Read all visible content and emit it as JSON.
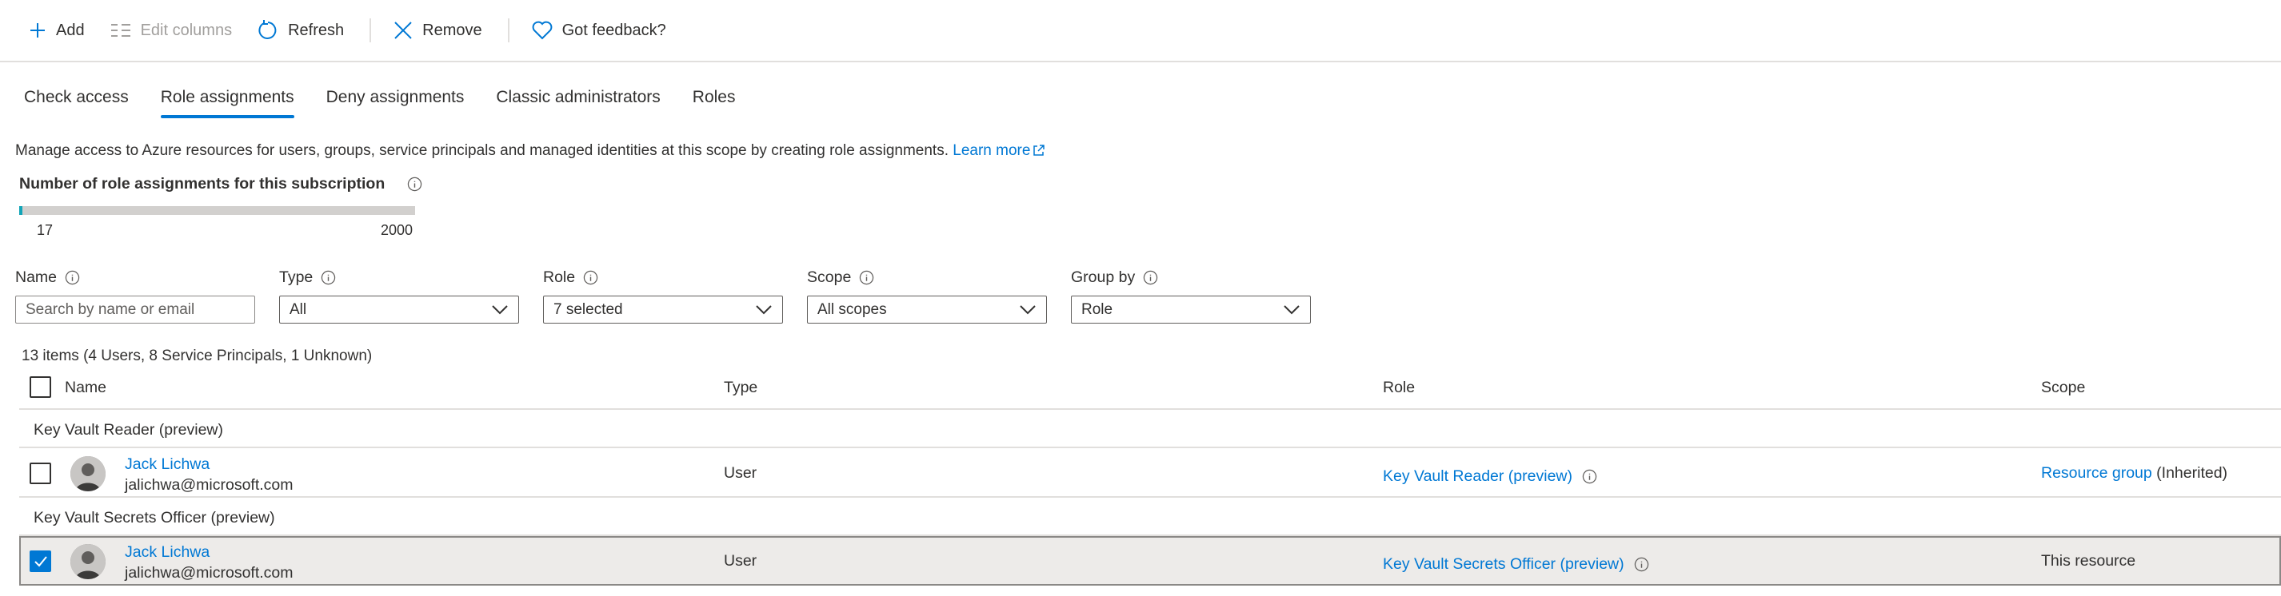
{
  "toolbar": {
    "add": "Add",
    "edit_columns": "Edit columns",
    "refresh": "Refresh",
    "remove": "Remove",
    "feedback": "Got feedback?"
  },
  "tabs": [
    {
      "label": "Check access",
      "active": false
    },
    {
      "label": "Role assignments",
      "active": true
    },
    {
      "label": "Deny assignments",
      "active": false
    },
    {
      "label": "Classic administrators",
      "active": false
    },
    {
      "label": "Roles",
      "active": false
    }
  ],
  "description": {
    "text": "Manage access to Azure resources for users, groups, service principals and managed identities at this scope by creating role assignments.",
    "link": "Learn more"
  },
  "assignment_count": {
    "title": "Number of role assignments for this subscription",
    "current": "17",
    "max": "2000",
    "fraction": 0.0085
  },
  "filters": {
    "name": {
      "label": "Name",
      "placeholder": "Search by name or email"
    },
    "type": {
      "label": "Type",
      "value": "All"
    },
    "role": {
      "label": "Role",
      "value": "7 selected"
    },
    "scope": {
      "label": "Scope",
      "value": "All scopes"
    },
    "group_by": {
      "label": "Group by",
      "value": "Role"
    }
  },
  "summary": "13 items (4 Users, 8 Service Principals, 1 Unknown)",
  "columns": {
    "name": "Name",
    "type": "Type",
    "role": "Role",
    "scope": "Scope"
  },
  "groups": [
    {
      "label": "Key Vault Reader (preview)",
      "rows": [
        {
          "name": "Jack Lichwa",
          "email": "jalichwa@microsoft.com",
          "type": "User",
          "role": "Key Vault Reader (preview)",
          "scope_link": "Resource group",
          "scope_suffix": "(Inherited)",
          "checked": false
        }
      ]
    },
    {
      "label": "Key Vault Secrets Officer (preview)",
      "rows": [
        {
          "name": "Jack Lichwa",
          "email": "jalichwa@microsoft.com",
          "type": "User",
          "role": "Key Vault Secrets Officer (preview)",
          "scope_text": "This resource",
          "checked": true
        }
      ]
    }
  ],
  "colors": {
    "accent": "#0078d4",
    "progress": "#12a5b8"
  }
}
